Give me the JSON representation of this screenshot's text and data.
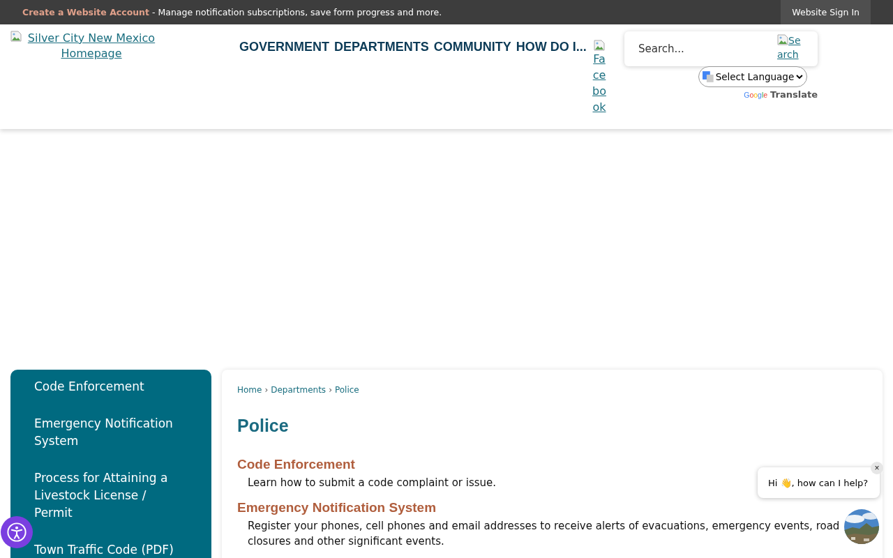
{
  "top_bar": {
    "account_link": "Create a Website Account",
    "message": "- Manage notification subscriptions, save form progress and more.",
    "sign_in": "Website Sign In"
  },
  "header": {
    "logo_alt": "Silver City New Mexico Homepage",
    "nav": [
      "GOVERNMENT",
      "DEPARTMENTS",
      "COMMUNITY",
      "HOW DO I..."
    ],
    "social_alt": "Facebook",
    "search": {
      "placeholder": "Search...",
      "button_alt": "Search"
    },
    "language_select": "Select Language",
    "translate": {
      "brand": "Google",
      "label": "Translate"
    }
  },
  "sidebar": {
    "items": [
      "Code Enforcement",
      "Emergency Notification System",
      "Process for Attaining a Livestock License / Permit",
      "Town Traffic Code (PDF)"
    ]
  },
  "breadcrumbs": [
    "Home",
    "Departments",
    "Police"
  ],
  "breadcrumb_separator": "›",
  "title": "Police",
  "sections": [
    {
      "title": "Code Enforcement",
      "description": "Learn how to submit a code complaint or issue."
    },
    {
      "title": "Emergency Notification System",
      "description": "Register your phones, cell phones and email addresses to receive alerts of evacuations, emergency events, road closures and other significant events."
    }
  ],
  "chat": {
    "message": "Hi 👋, how can I help?",
    "close": "×"
  }
}
